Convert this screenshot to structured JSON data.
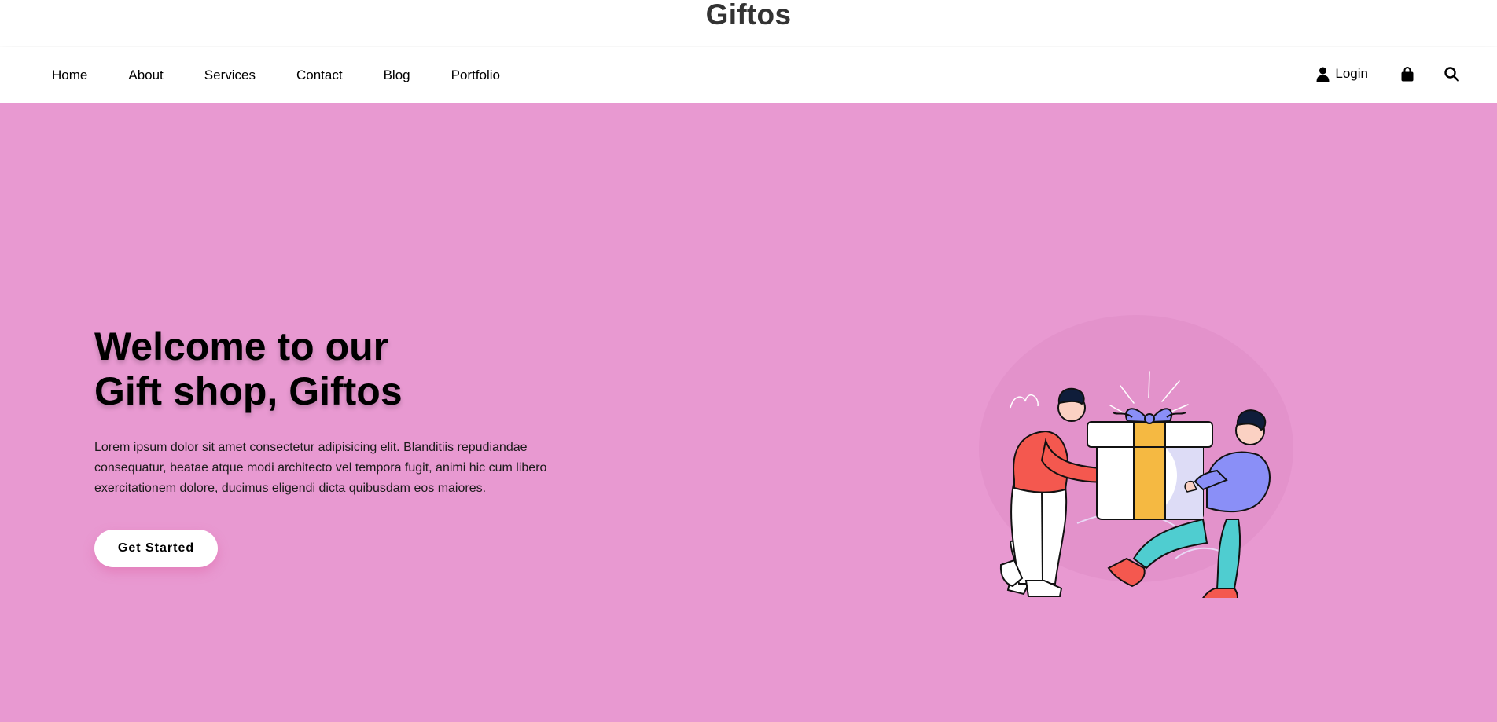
{
  "brand": {
    "name": "Giftos"
  },
  "nav": {
    "links": [
      "Home",
      "About",
      "Services",
      "Contact",
      "Blog",
      "Portfolio"
    ],
    "login_label": "Login",
    "icons": [
      "user-icon",
      "shopping-bag-icon",
      "search-icon"
    ]
  },
  "hero": {
    "title_line1": "Welcome to our",
    "title_line2": "Gift shop, Giftos",
    "description": "Lorem ipsum dolor sit amet consectetur adipisicing elit. Blanditiis repudiandae consequatur, beatae atque modi architecto vel tempora fugit, animi hic cum libero exercitationem dolore, ducimus eligendi dicta quibusdam eos maiores.",
    "cta_label": "Get Started",
    "illustration": "two-people-carrying-gift-box"
  },
  "colors": {
    "hero_background": "#e899d1",
    "brand_text": "#333333",
    "button_background": "#ffffff"
  }
}
